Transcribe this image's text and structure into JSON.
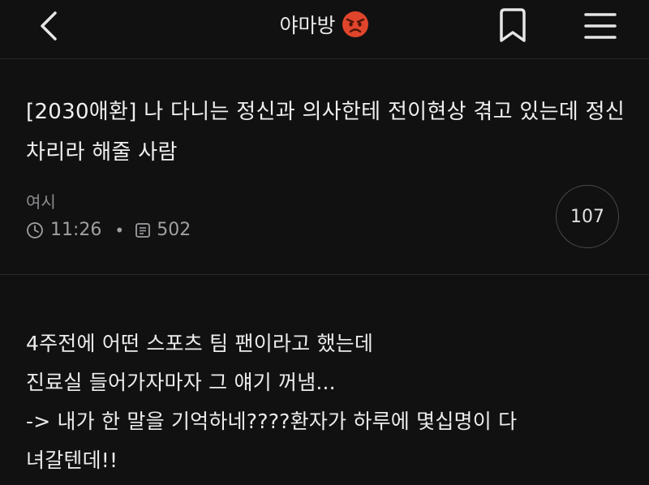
{
  "header": {
    "title": "야마방",
    "title_emoji": "angry-face-icon"
  },
  "post": {
    "title": "[2030애환] 나 다니는 정신과 의사한테 전이현상 겪고 있는데 정신차리라 해줄 사람",
    "author": "여시",
    "time": "11:26",
    "views": "502",
    "comment_count": "107"
  },
  "body": {
    "lines": [
      "4주전에 어떤 스포츠 팀 팬이라고 했는데",
      "진료실 들어가자마자 그 얘기 꺼냄...",
      "-> 내가 한 말을 기억하네????환자가 하루에 몇십명이 다",
      "녀갈텐데!!"
    ]
  },
  "colors": {
    "background": "#111112",
    "divider": "#2a2a2c",
    "muted_text": "#8d8d90",
    "emoji": "#e0452b"
  }
}
